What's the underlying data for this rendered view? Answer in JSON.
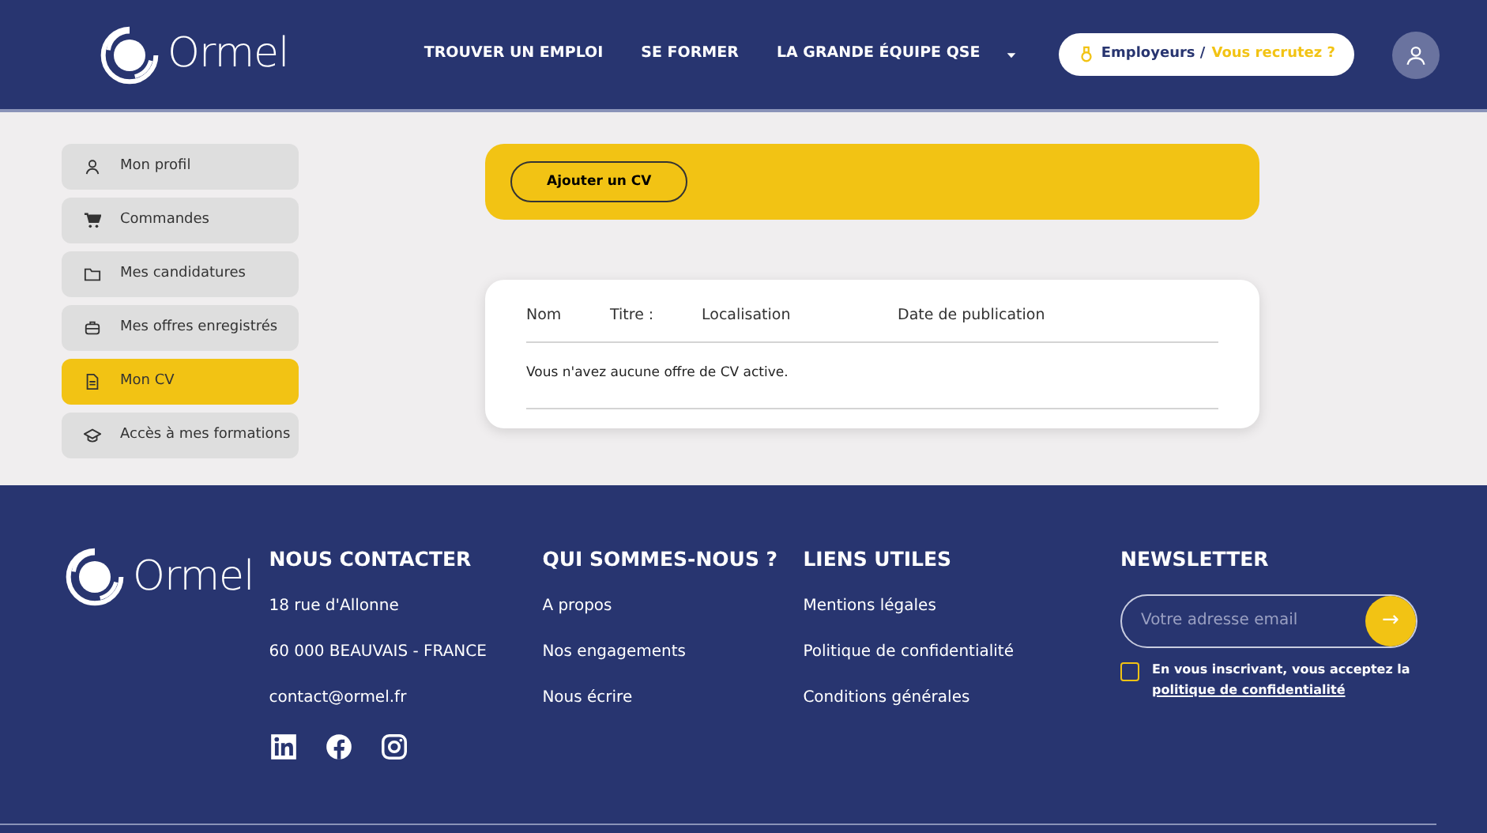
{
  "header": {
    "logo": "Ormel",
    "nav": [
      {
        "label": "TROUVER UN EMPLOI",
        "dropdown": false
      },
      {
        "label": "SE FORMER",
        "dropdown": false
      },
      {
        "label": "LA GRANDE ÉQUIPE QSE",
        "dropdown": true
      }
    ],
    "employer_button": {
      "label": "Employeurs /",
      "highlight": "Vous recrutez ?"
    }
  },
  "sidebar": {
    "items": [
      {
        "label": "Mon profil",
        "selected": false
      },
      {
        "label": "Commandes",
        "selected": false
      },
      {
        "label": "Mes candidatures",
        "selected": false
      },
      {
        "label": "Mes offres enregistrés",
        "selected": false
      },
      {
        "label": "Mon CV",
        "selected": true
      },
      {
        "label": "Accès à mes formations",
        "selected": false
      }
    ]
  },
  "toolbar": {
    "button": "Ajouter un CV"
  },
  "table": {
    "columns": [
      "Nom",
      "Titre :",
      "Localisation",
      "Date de publication"
    ],
    "empty_message": "Vous n'avez aucune offre de CV active."
  },
  "footer": {
    "logo": "Ormel",
    "columns": [
      {
        "title": "NOUS CONTACTER",
        "links": [
          "18 rue d'Allonne",
          "60 000 BEAUVAIS - FRANCE",
          "contact@ormel.fr"
        ]
      },
      {
        "title": "QUI SOMMES-NOUS ?",
        "links": [
          "A propos",
          "Nos engagements",
          "Nous écrire"
        ]
      },
      {
        "title": "LIENS UTILES",
        "links": [
          "Mentions légales",
          "Politique de confidentialité",
          "Conditions générales"
        ]
      }
    ],
    "newsletter": {
      "title": "NEWSLETTER",
      "placeholder": "Votre adresse email",
      "submit": "→",
      "checked": false,
      "consent": "En vous inscrivant, vous acceptez la",
      "consent_link": "politique de confidentialité"
    }
  }
}
